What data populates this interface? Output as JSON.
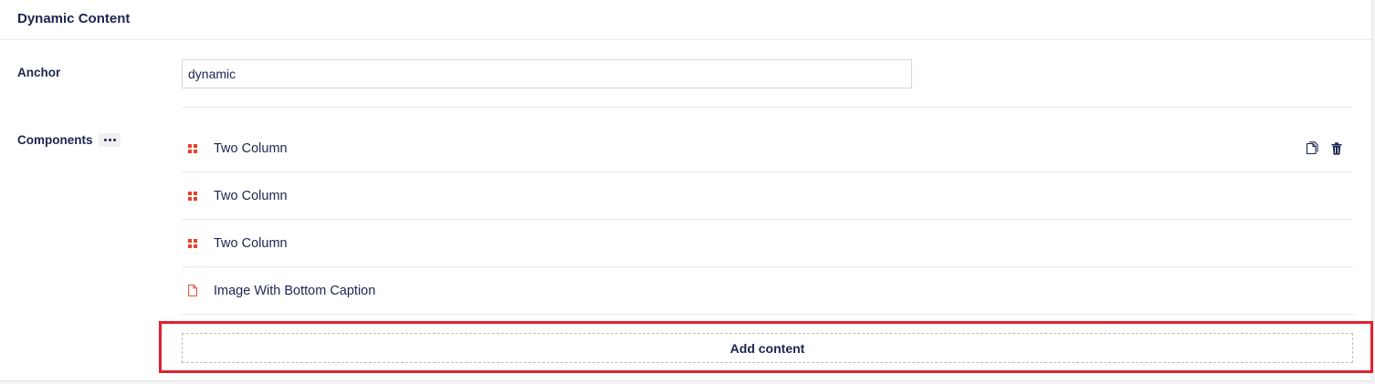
{
  "panel": {
    "title": "Dynamic Content"
  },
  "anchor": {
    "label": "Anchor",
    "value": "dynamic"
  },
  "components": {
    "label": "Components",
    "items": [
      {
        "name": "Two Column",
        "icon": "grid-icon"
      },
      {
        "name": "Two Column",
        "icon": "grid-icon"
      },
      {
        "name": "Two Column",
        "icon": "grid-icon"
      },
      {
        "name": "Image With Bottom Caption",
        "icon": "document-icon"
      }
    ],
    "add_label": "Add content"
  },
  "colors": {
    "accent": "#e8412c",
    "text": "#1b264f",
    "highlight": "#e2202f"
  }
}
